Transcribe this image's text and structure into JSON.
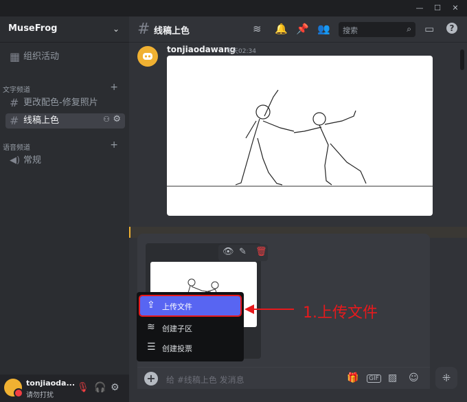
{
  "window": {
    "minimize": "—",
    "maximize": "☐",
    "close": "✕"
  },
  "server": {
    "name": "MuseFrog",
    "top_item": "组织活动",
    "categories": [
      {
        "label": "文字频道"
      },
      {
        "label": "语音频道"
      }
    ],
    "text_channels": [
      {
        "label": "更改配色-修复照片"
      },
      {
        "label": "线稿上色",
        "active": true
      }
    ],
    "voice_channels": [
      {
        "label": "常规"
      }
    ]
  },
  "user": {
    "name": "tonjiaoda...",
    "status": "请勿打扰"
  },
  "channel": {
    "title": "线稿上色",
    "search_placeholder": "搜索"
  },
  "message": {
    "author": "tonjiaodawang",
    "time": "今天02:34"
  },
  "composer": {
    "placeholder": "给 #线稿上色 发消息",
    "gif_label": "GIF"
  },
  "upload_menu": {
    "items": [
      {
        "label": "上传文件",
        "icon": "file-upload-icon"
      },
      {
        "label": "创建子区",
        "icon": "thread-icon"
      },
      {
        "label": "创建投票",
        "icon": "poll-icon"
      }
    ]
  },
  "annotation": {
    "text": "1.上传文件"
  },
  "colors": {
    "accent": "#5865f2",
    "annotation_red": "#e8191c",
    "avatar_bg": "#f0b132",
    "danger": "#f23f43"
  }
}
